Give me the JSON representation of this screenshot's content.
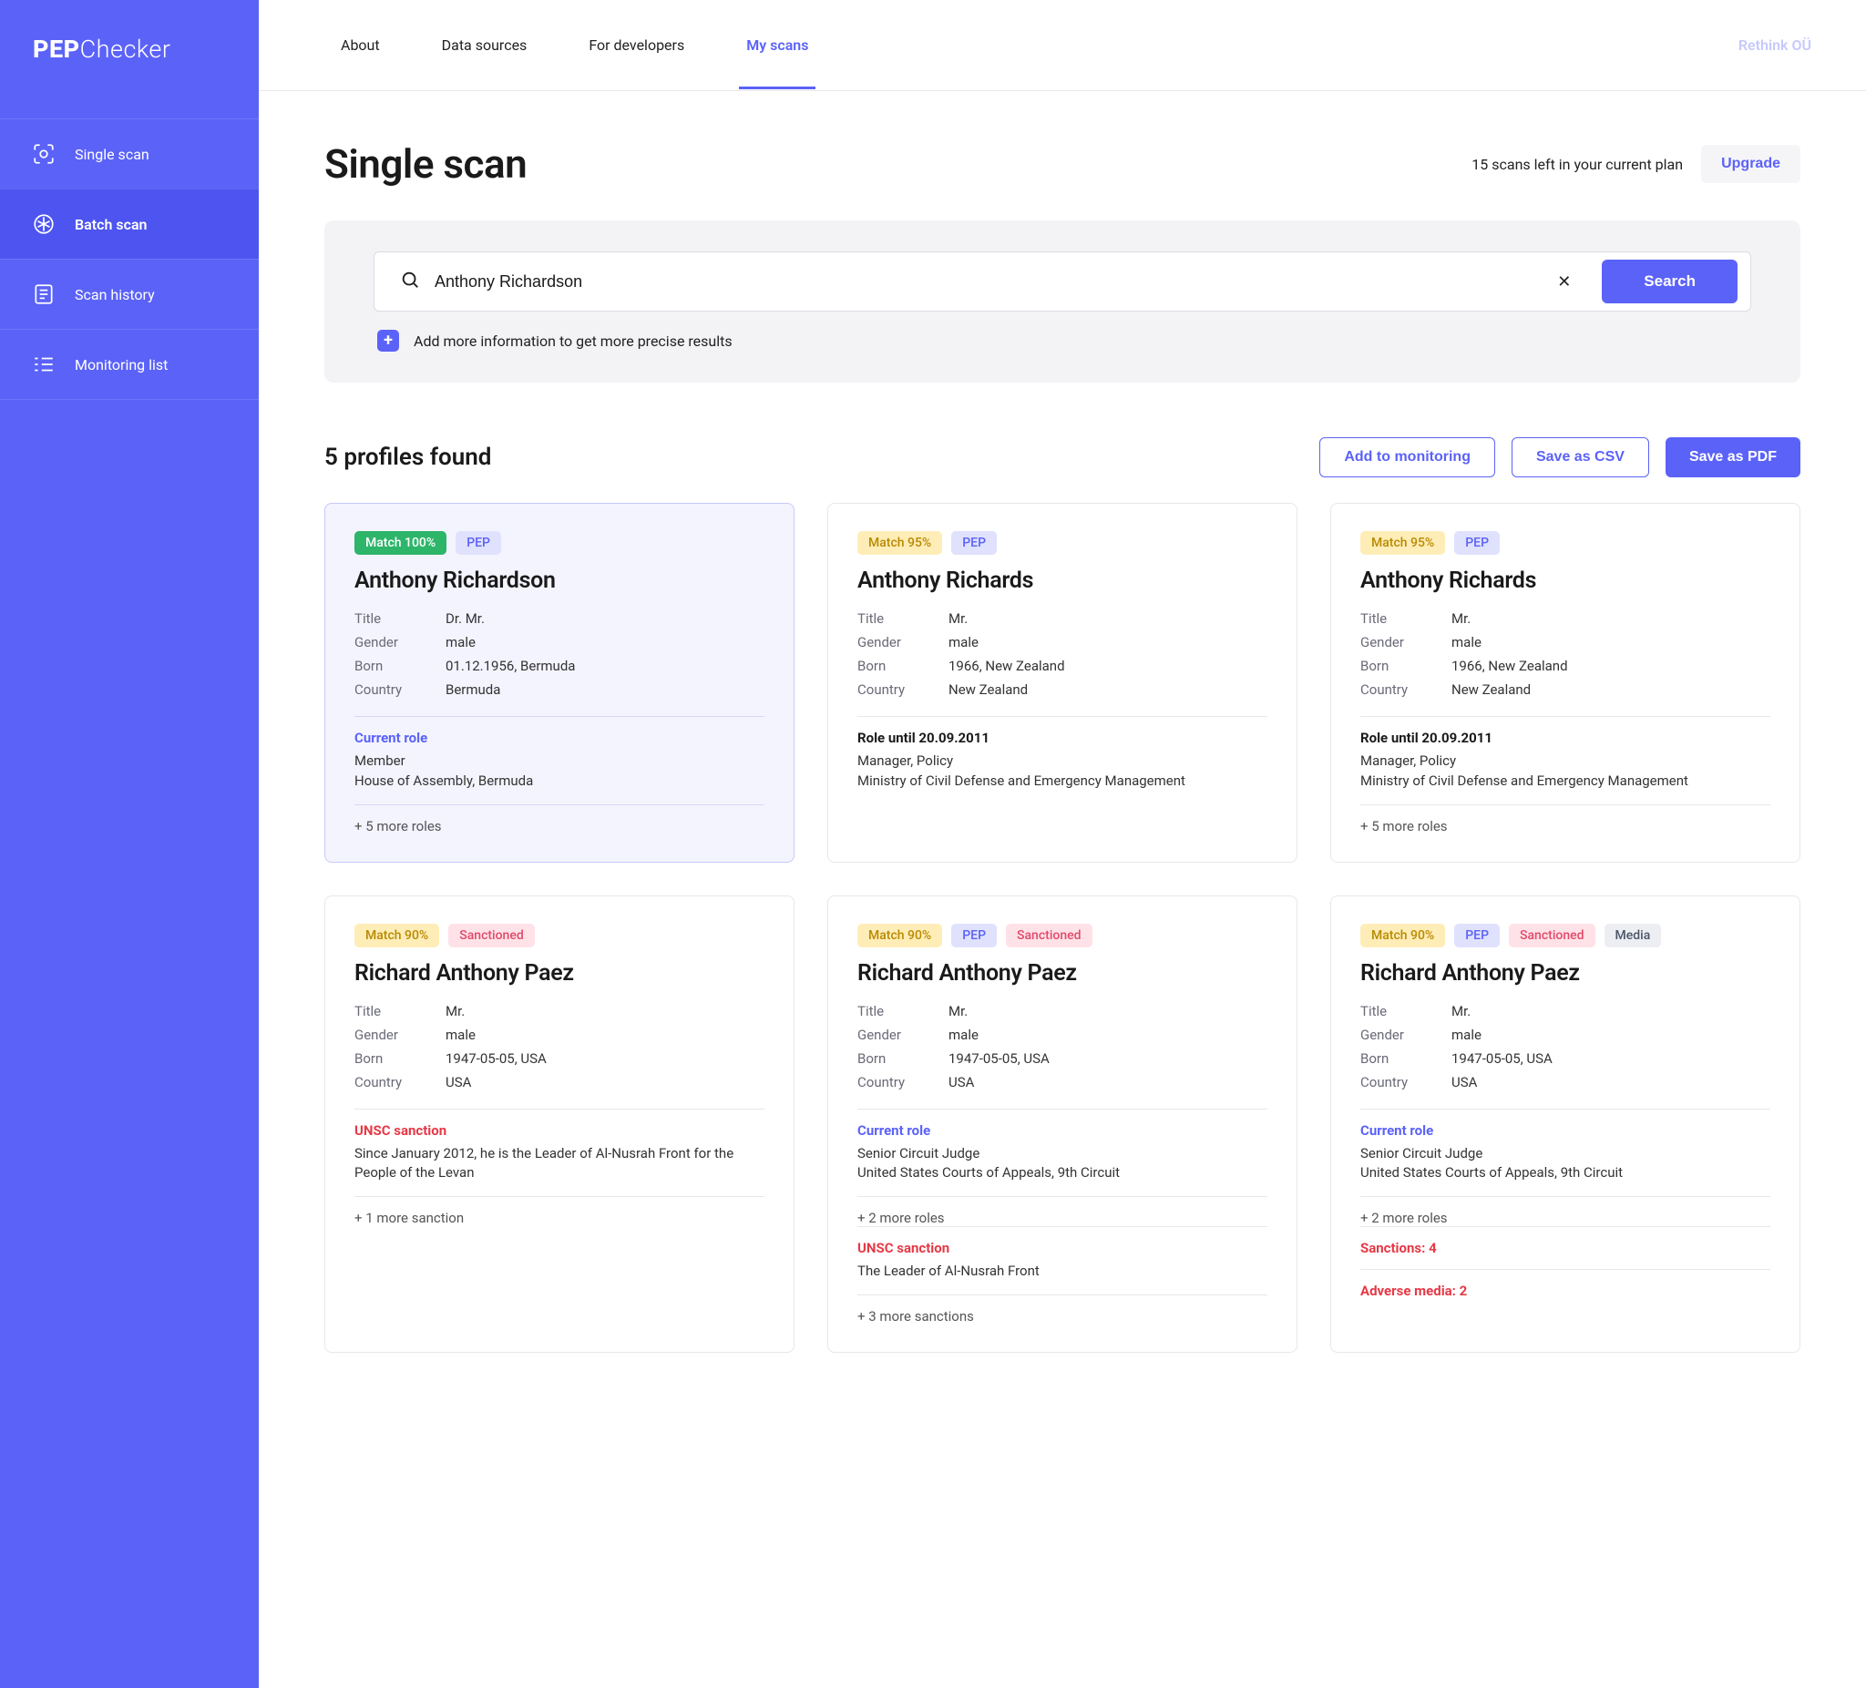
{
  "brand": {
    "bold": "PEP",
    "thin": "Checker"
  },
  "sidebar": {
    "items": [
      {
        "label": "Single scan"
      },
      {
        "label": "Batch scan"
      },
      {
        "label": "Scan history"
      },
      {
        "label": "Monitoring list"
      }
    ]
  },
  "nav": {
    "tabs": [
      {
        "label": "About"
      },
      {
        "label": "Data sources"
      },
      {
        "label": "For developers"
      },
      {
        "label": "My scans"
      }
    ],
    "org": "Rethink OÜ"
  },
  "page": {
    "title": "Single scan",
    "remaining": "15 scans left in your current plan",
    "upgrade": "Upgrade"
  },
  "search": {
    "query": "Anthony Richardson",
    "button": "Search",
    "add_info": "Add more information to get more precise results"
  },
  "results": {
    "title": "5 profiles found",
    "actions": {
      "monitoring": "Add to monitoring",
      "csv": "Save as CSV",
      "pdf": "Save as PDF"
    }
  },
  "field_labels": {
    "title": "Title",
    "gender": "Gender",
    "born": "Born",
    "country": "Country"
  },
  "cards": [
    {
      "highlight": true,
      "badges": [
        {
          "text": "Match 100%",
          "cls": "green"
        },
        {
          "text": "PEP",
          "cls": "violet"
        }
      ],
      "name": "Anthony Richardson",
      "attrs": {
        "title": "Dr. Mr.",
        "gender": "male",
        "born": "01.12.1956, Bermuda",
        "country": "Bermuda"
      },
      "sections": [
        {
          "title": "Current role",
          "titleStyle": "blue",
          "lines": [
            "Member",
            "House of Assembly, Bermuda"
          ],
          "more": "+ 5 more roles"
        }
      ]
    },
    {
      "badges": [
        {
          "text": "Match 95%",
          "cls": "yellow"
        },
        {
          "text": "PEP",
          "cls": "violet"
        }
      ],
      "name": "Anthony Richards",
      "attrs": {
        "title": "Mr.",
        "gender": "male",
        "born": "1966, New Zealand",
        "country": "New Zealand"
      },
      "sections": [
        {
          "title": "Role until 20.09.2011",
          "titleStyle": "black",
          "lines": [
            "Manager, Policy",
            "Ministry of Civil Defense and Emergency Management"
          ]
        }
      ]
    },
    {
      "badges": [
        {
          "text": "Match 95%",
          "cls": "yellow"
        },
        {
          "text": "PEP",
          "cls": "violet"
        }
      ],
      "name": "Anthony Richards",
      "attrs": {
        "title": "Mr.",
        "gender": "male",
        "born": "1966, New Zealand",
        "country": "New Zealand"
      },
      "sections": [
        {
          "title": "Role until 20.09.2011",
          "titleStyle": "black",
          "lines": [
            "Manager, Policy",
            "Ministry of Civil Defense and Emergency Management"
          ],
          "more": "+ 5 more roles"
        }
      ]
    },
    {
      "badges": [
        {
          "text": "Match 90%",
          "cls": "yellow"
        },
        {
          "text": "Sanctioned",
          "cls": "pink"
        }
      ],
      "name": "Richard Anthony Paez",
      "attrs": {
        "title": "Mr.",
        "gender": "male",
        "born": "1947-05-05, USA",
        "country": "USA"
      },
      "sections": [
        {
          "title": "UNSC sanction",
          "titleStyle": "red",
          "lines": [
            "Since January 2012, he is the Leader of Al-Nusrah Front for the People of the Levan"
          ],
          "more": "+ 1 more sanction"
        }
      ]
    },
    {
      "badges": [
        {
          "text": "Match 90%",
          "cls": "yellow"
        },
        {
          "text": "PEP",
          "cls": "violet"
        },
        {
          "text": "Sanctioned",
          "cls": "pink"
        }
      ],
      "name": "Richard Anthony Paez",
      "attrs": {
        "title": "Mr.",
        "gender": "male",
        "born": "1947-05-05, USA",
        "country": "USA"
      },
      "sections": [
        {
          "title": "Current role",
          "titleStyle": "blue",
          "lines": [
            "Senior Circuit Judge",
            "United States Courts of Appeals, 9th Circuit"
          ],
          "more": "+ 2 more roles"
        },
        {
          "title": "UNSC sanction",
          "titleStyle": "red",
          "lines": [
            "The Leader of Al-Nusrah Front"
          ],
          "more": "+ 3 more sanctions"
        }
      ]
    },
    {
      "badges": [
        {
          "text": "Match 90%",
          "cls": "yellow"
        },
        {
          "text": "PEP",
          "cls": "violet"
        },
        {
          "text": "Sanctioned",
          "cls": "pink"
        },
        {
          "text": "Media",
          "cls": "gray"
        }
      ],
      "name": "Richard Anthony Paez",
      "attrs": {
        "title": "Mr.",
        "gender": "male",
        "born": "1947-05-05, USA",
        "country": "USA"
      },
      "sections": [
        {
          "title": "Current role",
          "titleStyle": "blue",
          "lines": [
            "Senior Circuit Judge",
            "United States Courts of Appeals, 9th Circuit"
          ],
          "more": "+ 2 more roles"
        },
        {
          "title": "Sanctions: 4",
          "titleStyle": "red",
          "lines": []
        },
        {
          "title": "Adverse media: 2",
          "titleStyle": "red",
          "lines": []
        }
      ]
    }
  ]
}
